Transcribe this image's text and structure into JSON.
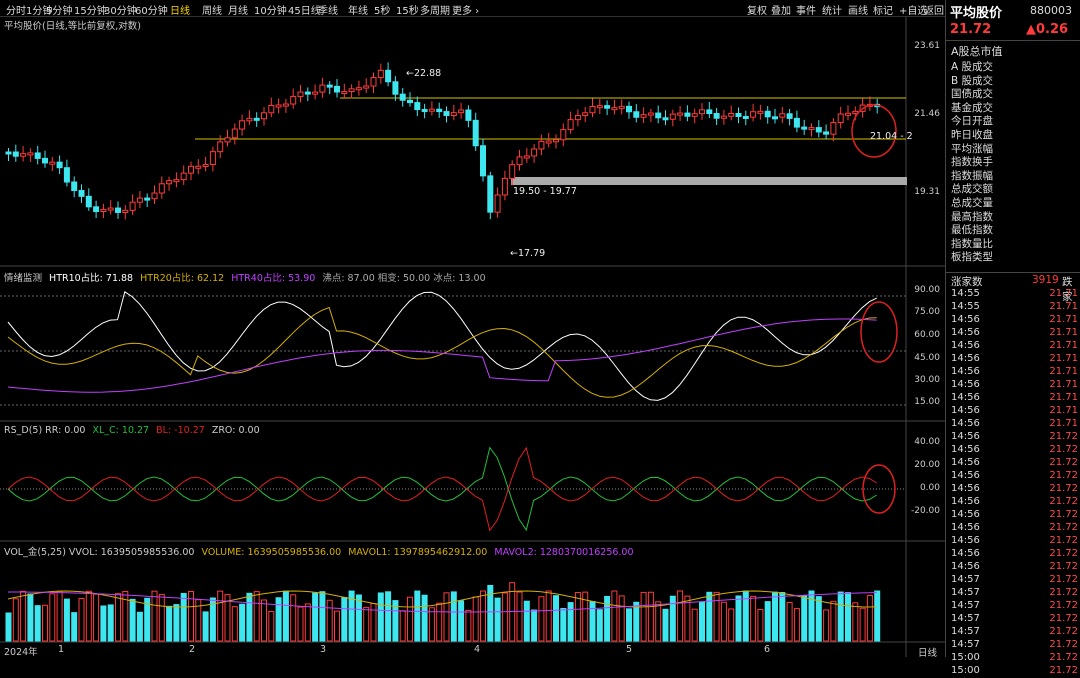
{
  "toolbar": {
    "periods": [
      "分时",
      "1分钟",
      "5分钟",
      "15分钟",
      "30分钟",
      "60分钟",
      "日线",
      "周线",
      "月线",
      "10分钟",
      "45日线",
      "季线",
      "年线",
      "5秒",
      "15秒",
      "多周期",
      "更多 ›"
    ],
    "active_period": "日线",
    "actions": [
      "复权",
      "叠加",
      "事件",
      "统计",
      "画线",
      "标记",
      "+自选",
      "返回"
    ]
  },
  "header": {
    "name": "平均股价",
    "code": "880003",
    "price": "21.72",
    "change": "▲0.26"
  },
  "chart_title": "平均股价(日线,等比前复权,对数)",
  "price_panel": {
    "y_ticks": [
      "23.61",
      "21.46",
      "19.31"
    ],
    "annotations": {
      "high": "22.88",
      "low": "17.79",
      "gap": "19.50 - 19.77",
      "right": "21.04 - 2"
    }
  },
  "htr_panel": {
    "caption_prefix": "情绪监测",
    "htr10": "HTR10占比: 71.88",
    "htr20": "HTR20占比: 62.12",
    "htr40": "HTR40占比: 53.90",
    "extra": "沸点: 87.00  相变: 50.00  冰点: 13.00",
    "y_ticks": [
      "90.00",
      "75.00",
      "60.00",
      "45.00",
      "30.00",
      "15.00"
    ]
  },
  "rsd_panel": {
    "caption": "RS_D(5)  RR: 0.00",
    "xl": "XL_C: 10.27",
    "bl": "BL: -10.27",
    "zro": "ZRO: 0.00",
    "y_ticks": [
      "40.00",
      "20.00",
      "0.00",
      "-20.00"
    ]
  },
  "vol_panel": {
    "caption": "VOL_金(5,25)  VVOL: 1639505985536.00",
    "volume": "VOLUME: 1639505985536.00",
    "mavol1": "MAVOL1: 1397895462912.00",
    "mavol2": "MAVOL2: 1280370016256.00"
  },
  "x_axis": {
    "labels": [
      "2024年",
      "1",
      "2",
      "3",
      "4",
      "5",
      "6"
    ],
    "right_label": "日线"
  },
  "colors": {
    "up": "#ff3b3b",
    "down": "#3ee6f0",
    "yellow_line": "#d4c400",
    "htr10": "#ffffff",
    "htr20": "#d4b000",
    "htr40": "#c040ff",
    "rs_green": "#22c03a",
    "rs_red": "#e02020",
    "mavol1": "#d4b000",
    "mavol2": "#c040ff"
  },
  "side_menu": {
    "title": "A股总市值",
    "items": [
      "A 股成交",
      "B 股成交",
      "国债成交",
      "基金成交",
      "今日开盘",
      "昨日收盘",
      "平均涨幅",
      "指数换手",
      "指数振幅",
      "总成交额",
      "总成交量",
      "最高指数",
      "最低指数",
      "指数量比",
      "板指类型"
    ]
  },
  "ticks_header": {
    "label": "涨家数",
    "value": "3919",
    "label2": "跌家"
  },
  "ticks": [
    {
      "t": "14:55",
      "p": "21.71"
    },
    {
      "t": "14:55",
      "p": "21.71"
    },
    {
      "t": "14:56",
      "p": "21.71"
    },
    {
      "t": "14:56",
      "p": "21.71"
    },
    {
      "t": "14:56",
      "p": "21.71"
    },
    {
      "t": "14:56",
      "p": "21.71"
    },
    {
      "t": "14:56",
      "p": "21.71"
    },
    {
      "t": "14:56",
      "p": "21.71"
    },
    {
      "t": "14:56",
      "p": "21.71"
    },
    {
      "t": "14:56",
      "p": "21.71"
    },
    {
      "t": "14:56",
      "p": "21.71"
    },
    {
      "t": "14:56",
      "p": "21.72"
    },
    {
      "t": "14:56",
      "p": "21.72"
    },
    {
      "t": "14:56",
      "p": "21.72"
    },
    {
      "t": "14:56",
      "p": "21.72"
    },
    {
      "t": "14:56",
      "p": "21.72"
    },
    {
      "t": "14:56",
      "p": "21.72"
    },
    {
      "t": "14:56",
      "p": "21.72"
    },
    {
      "t": "14:56",
      "p": "21.72"
    },
    {
      "t": "14:56",
      "p": "21.72"
    },
    {
      "t": "14:56",
      "p": "21.72"
    },
    {
      "t": "14:56",
      "p": "21.72"
    },
    {
      "t": "14:57",
      "p": "21.72"
    },
    {
      "t": "14:57",
      "p": "21.72"
    },
    {
      "t": "14:57",
      "p": "21.72"
    },
    {
      "t": "14:57",
      "p": "21.72"
    },
    {
      "t": "14:57",
      "p": "21.72"
    },
    {
      "t": "14:57",
      "p": "21.72"
    },
    {
      "t": "15:00",
      "p": "21.72"
    },
    {
      "t": "15:00",
      "p": "21.72"
    }
  ]
}
